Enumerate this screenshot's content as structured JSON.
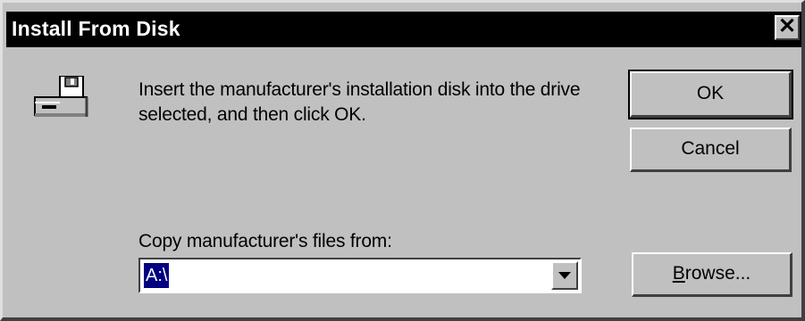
{
  "window": {
    "title": "Install From Disk",
    "close_label": "✕"
  },
  "message": {
    "text": "Insert the manufacturer's installation disk into the drive selected, and then click OK."
  },
  "buttons": {
    "ok": "OK",
    "cancel": "Cancel",
    "browse_mnemonic": "B",
    "browse_rest": "rowse..."
  },
  "copy_from": {
    "label": "Copy manufacturer's files from:",
    "value": "A:\\"
  },
  "icons": {
    "disk": "floppy-drive-icon",
    "close": "close-icon",
    "dropdown": "chevron-down-icon"
  },
  "colors": {
    "dialog_bg": "#c0c0c0",
    "titlebar_bg": "#000000",
    "selection_bg": "#000080"
  }
}
